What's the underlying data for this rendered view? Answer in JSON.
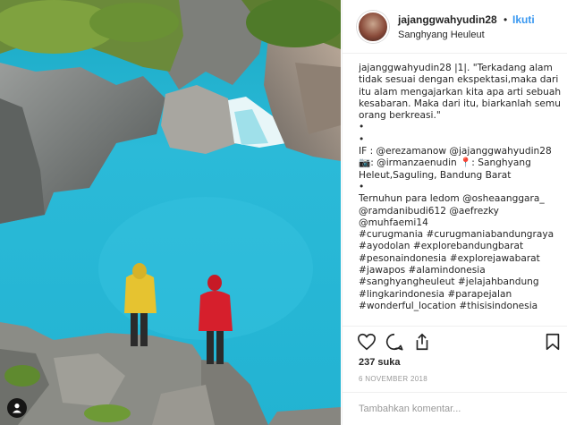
{
  "post": {
    "username": "jajanggwahyudin28",
    "separator": "•",
    "follow_label": "Ikuti",
    "location": "Sanghyang Heuleut",
    "caption_lines": [
      "jajanggwahyudin28 |1|. \"Terkadang alam",
      "tidak sesuai dengan ekspektasi,maka dari",
      "itu alam mengajarkan kita apa arti sebuah",
      "kesabaran. Maka dari itu, biarkanlah semua",
      "orang berkreasi.\"",
      "•",
      "•",
      "IF : @erezamanow @jajanggwahyudin28",
      "📷: @irmanzaenudin 📍: Sanghyang",
      "Heleut,Saguling, Bandung Barat",
      "•",
      "Ternuhun para ledom @osheaanggara_",
      "@ramdanibudi612 @aefrezky",
      "@muhfaemi14",
      "#curugmania #curugmaniabandungraya",
      "#ayodolan #explorebandungbarat",
      "#pesonaindonesia #explorejawabarat",
      "#jawapos #alamindonesia",
      "#sanghyangheuleut #jelajahbandung",
      "#lingkarindonesia #parapejalan",
      "#wonderful_location #thisisindonesia"
    ],
    "likes_text": "237 suka",
    "date_text": "6 NOVEMBER 2018",
    "comment_placeholder": "Tambahkan komentar..."
  },
  "icons": {
    "like": "heart-icon",
    "comment": "comment-icon",
    "share": "share-icon",
    "save": "bookmark-icon",
    "user_tag": "person-icon"
  },
  "colors": {
    "link": "#3897f0",
    "muted": "#999999",
    "text": "#262626",
    "water": "#27b6d4"
  }
}
